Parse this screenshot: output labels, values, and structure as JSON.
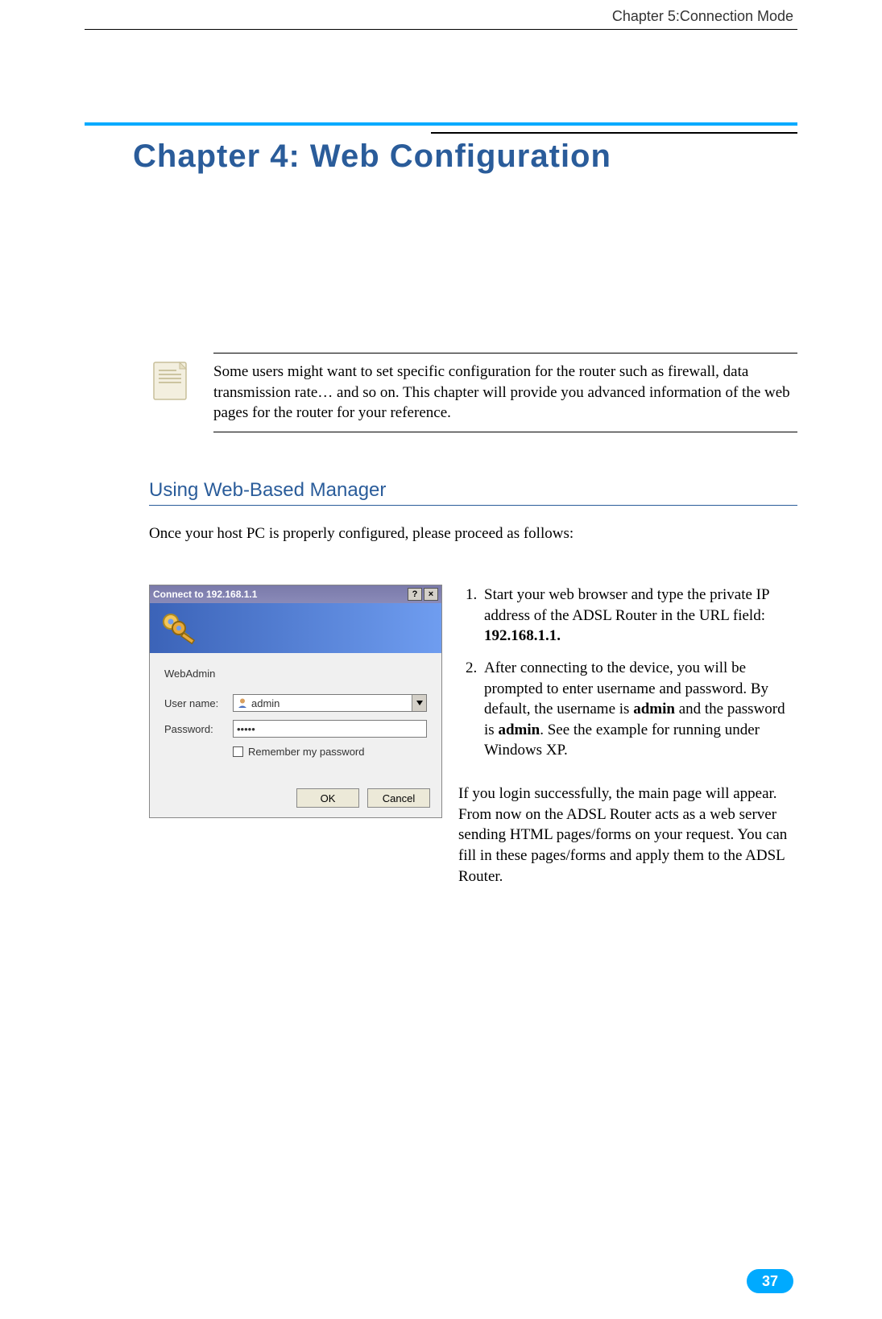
{
  "header": {
    "path": "Chapter 5:Connection Mode"
  },
  "chapter": {
    "title": "Chapter 4: Web Configuration"
  },
  "note": {
    "text": "Some users might want to set specific configuration for the router such as firewall, data transmission rate… and so on. This chapter will provide you advanced information of the web pages for the router for your reference."
  },
  "section": {
    "heading": "Using Web-Based Manager",
    "intro": "Once your host PC is properly configured, please proceed as follows:"
  },
  "dialog": {
    "title": "Connect to 192.168.1.1",
    "help_btn": "?",
    "close_btn": "×",
    "app_label": "WebAdmin",
    "user_label": "User name:",
    "user_value": "admin",
    "pass_label": "Password:",
    "pass_value": "•••••",
    "remember_label": "Remember my password",
    "ok_label": "OK",
    "cancel_label": "Cancel"
  },
  "steps": {
    "item1_a": "Start your web browser and type the private IP address of the ADSL Router in the URL field: ",
    "item1_b": "192.168.1.1.",
    "item2_a": "After connecting to the device, you will be prompted to enter username and password. By default, the username is ",
    "item2_b": "admin",
    "item2_c": " and the password is ",
    "item2_d": "admin",
    "item2_e": ". See the example for running under Windows XP.",
    "after": "If you login successfully, the main page will appear. From now on the ADSL Router acts as a web server sending HTML pages/forms on your request. You can fill in these pages/forms and apply them to the ADSL Router."
  },
  "page_number": "37"
}
